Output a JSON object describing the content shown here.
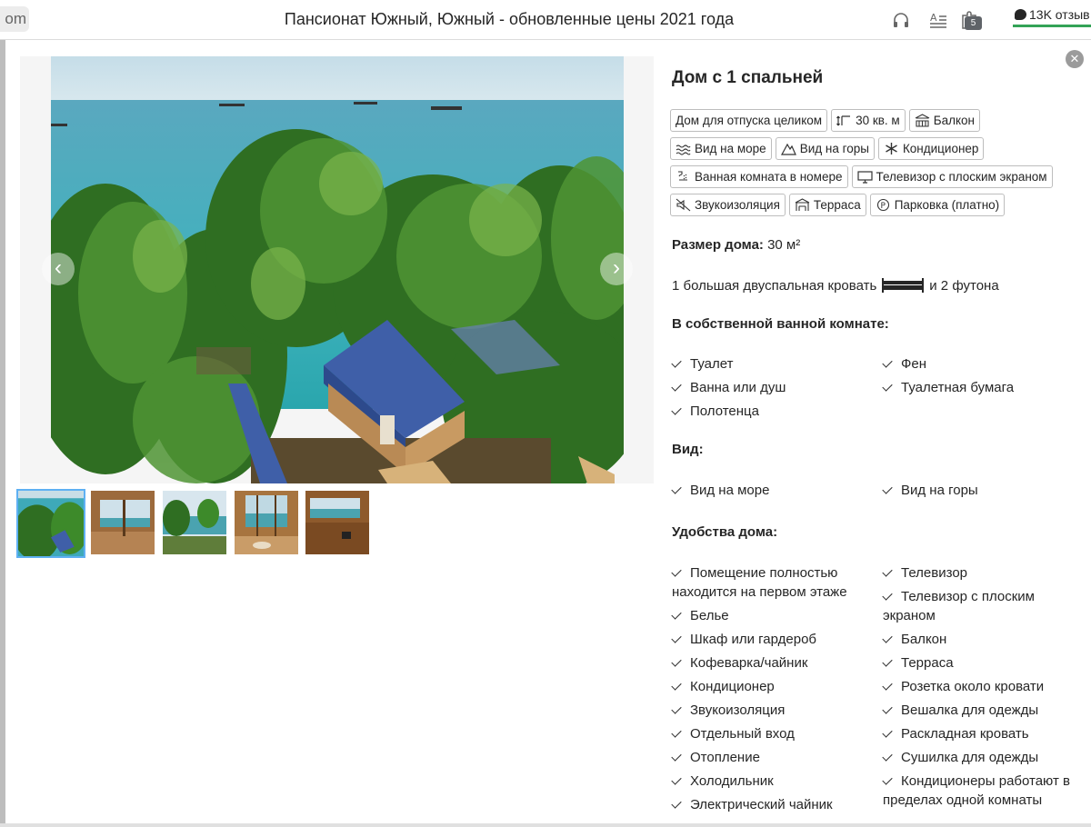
{
  "browser": {
    "url_fragment": "om",
    "title": "Пансионат Южный, Южный - обновленные цены 2021 года",
    "extension_badge": "5",
    "reviews": "13K отзыв",
    "icons": [
      "headphones-icon",
      "reader-icon",
      "extension-icon"
    ]
  },
  "gallery": {
    "prev_arrow": "‹",
    "next_arrow": "›",
    "thumbnails": [
      "thumb-1",
      "thumb-2",
      "thumb-3",
      "thumb-4",
      "thumb-5"
    ],
    "active_thumbnail": 1
  },
  "room": {
    "title": "Дом с 1 спальней",
    "chips": [
      [
        {
          "label": "Дом для отпуска целиком",
          "icon": ""
        },
        {
          "label": "30 кв. м",
          "icon": "area-icon"
        },
        {
          "label": "Балкон",
          "icon": "balcony-icon"
        }
      ],
      [
        {
          "label": "Вид на море",
          "icon": "sea-view-icon"
        },
        {
          "label": "Вид на горы",
          "icon": "mountain-icon"
        },
        {
          "label": "Кондиционер",
          "icon": "snowflake-icon"
        }
      ],
      [
        {
          "label": "Ванная комната в номере",
          "icon": "bath-icon"
        },
        {
          "label": "Телевизор с плоским экраном",
          "icon": "tv-icon"
        }
      ],
      [
        {
          "label": "Звукоизоляция",
          "icon": "soundproof-icon"
        },
        {
          "label": "Терраса",
          "icon": "terrace-icon"
        },
        {
          "label": "Парковка (платно)",
          "icon": "parking-icon"
        }
      ]
    ],
    "size_label": "Размер дома:",
    "size_value": "30 м²",
    "beds_text_1": "1 большая двуспальная кровать",
    "beds_text_2": "и 2 футона",
    "bathroom": {
      "heading": "В собственной ванной комнате:",
      "left": [
        "Туалет",
        "Ванна или душ",
        "Полотенца"
      ],
      "right": [
        "Фен",
        "Туалетная бумага"
      ]
    },
    "view": {
      "heading": "Вид:",
      "left": [
        "Вид на море"
      ],
      "right": [
        "Вид на горы"
      ]
    },
    "amenities": {
      "heading": "Удобства дома:",
      "left": [
        "Помещение полностью находится на первом этаже",
        "Белье",
        "Шкаф или гардероб",
        "Кофеварка/чайник",
        "Кондиционер",
        "Звукоизоляция",
        "Отдельный вход",
        "Отопление",
        "Холодильник",
        "Электрический чайник"
      ],
      "right": [
        "Телевизор",
        "Телевизор с плоским экраном",
        "Балкон",
        "Терраса",
        "Розетка около кровати",
        "Вешалка для одежды",
        "Раскладная кровать",
        "Сушилка для одежды",
        "Кондиционеры работают в пределах одной комнаты"
      ]
    }
  }
}
